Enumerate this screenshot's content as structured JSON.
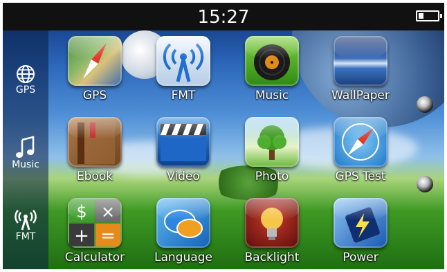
{
  "status_bar": {
    "time": "15:27",
    "battery_level": 0.25
  },
  "sidebar": {
    "items": [
      {
        "label": "GPS",
        "icon": "globe-icon"
      },
      {
        "label": "Music",
        "icon": "music-note-icon"
      },
      {
        "label": "FMT",
        "icon": "antenna-icon"
      }
    ]
  },
  "apps": [
    {
      "label": "GPS",
      "icon": "compass-map-icon"
    },
    {
      "label": "FMT",
      "icon": "broadcast-tower-icon"
    },
    {
      "label": "Music",
      "icon": "vinyl-record-icon"
    },
    {
      "label": "WallPaper",
      "icon": "landscape-icon"
    },
    {
      "label": "Ebook",
      "icon": "book-icon"
    },
    {
      "label": "Video",
      "icon": "clapperboard-icon"
    },
    {
      "label": "Photo",
      "icon": "tree-photo-icon"
    },
    {
      "label": "GPS Test",
      "icon": "compass-icon"
    },
    {
      "label": "Calculator",
      "icon": "calculator-icon"
    },
    {
      "label": "Language",
      "icon": "speech-bubbles-icon"
    },
    {
      "label": "Backlight",
      "icon": "lightbulb-icon"
    },
    {
      "label": "Power",
      "icon": "battery-charge-icon"
    }
  ]
}
